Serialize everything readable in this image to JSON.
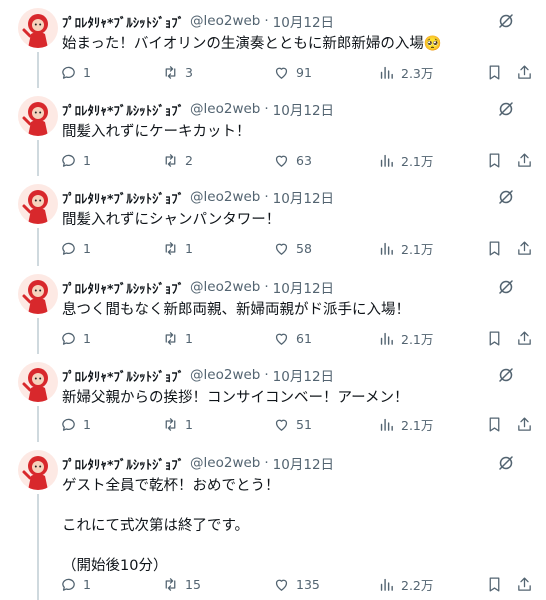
{
  "colors": {
    "text": "#0f1419",
    "muted": "#536471",
    "thread_line": "#cfd9de",
    "avatar_red": "#d8282c"
  },
  "tweets": [
    {
      "name": "ﾌﾟﾛﾚﾀﾘｬ*ﾌﾞﾙｼｯﾄｼﾞｮﾌﾞ",
      "handle": "@leo2web",
      "sep": "·",
      "date": "10月12日",
      "text": "始まった！バイオリンの生演奏とともに新郎新婦の入場🥺",
      "replies": "1",
      "retweets": "3",
      "likes": "91",
      "views": "2.3万"
    },
    {
      "name": "ﾌﾟﾛﾚﾀﾘｬ*ﾌﾞﾙｼｯﾄｼﾞｮﾌﾞ",
      "handle": "@leo2web",
      "sep": "·",
      "date": "10月12日",
      "text": "間髪入れずにケーキカット！",
      "replies": "1",
      "retweets": "2",
      "likes": "63",
      "views": "2.1万"
    },
    {
      "name": "ﾌﾟﾛﾚﾀﾘｬ*ﾌﾞﾙｼｯﾄｼﾞｮﾌﾞ",
      "handle": "@leo2web",
      "sep": "·",
      "date": "10月12日",
      "text": "間髪入れずにシャンパンタワー！",
      "replies": "1",
      "retweets": "1",
      "likes": "58",
      "views": "2.1万"
    },
    {
      "name": "ﾌﾟﾛﾚﾀﾘｬ*ﾌﾞﾙｼｯﾄｼﾞｮﾌﾞ",
      "handle": "@leo2web",
      "sep": "·",
      "date": "10月12日",
      "text": "息つく間もなく新郎両親、新婦両親がド派手に入場！",
      "replies": "1",
      "retweets": "1",
      "likes": "61",
      "views": "2.1万"
    },
    {
      "name": "ﾌﾟﾛﾚﾀﾘｬ*ﾌﾞﾙｼｯﾄｼﾞｮﾌﾞ",
      "handle": "@leo2web",
      "sep": "·",
      "date": "10月12日",
      "text": "新婦父親からの挨拶！コンサイコンベー！アーメン！",
      "replies": "1",
      "retweets": "1",
      "likes": "51",
      "views": "2.1万"
    },
    {
      "name": "ﾌﾟﾛﾚﾀﾘｬ*ﾌﾞﾙｼｯﾄｼﾞｮﾌﾞ",
      "handle": "@leo2web",
      "sep": "·",
      "date": "10月12日",
      "text": "ゲスト全員で乾杯！おめでとう！\n\nこれにて式次第は終了です。\n\n（開始後10分）",
      "replies": "1",
      "retweets": "15",
      "likes": "135",
      "views": "2.2万"
    }
  ]
}
